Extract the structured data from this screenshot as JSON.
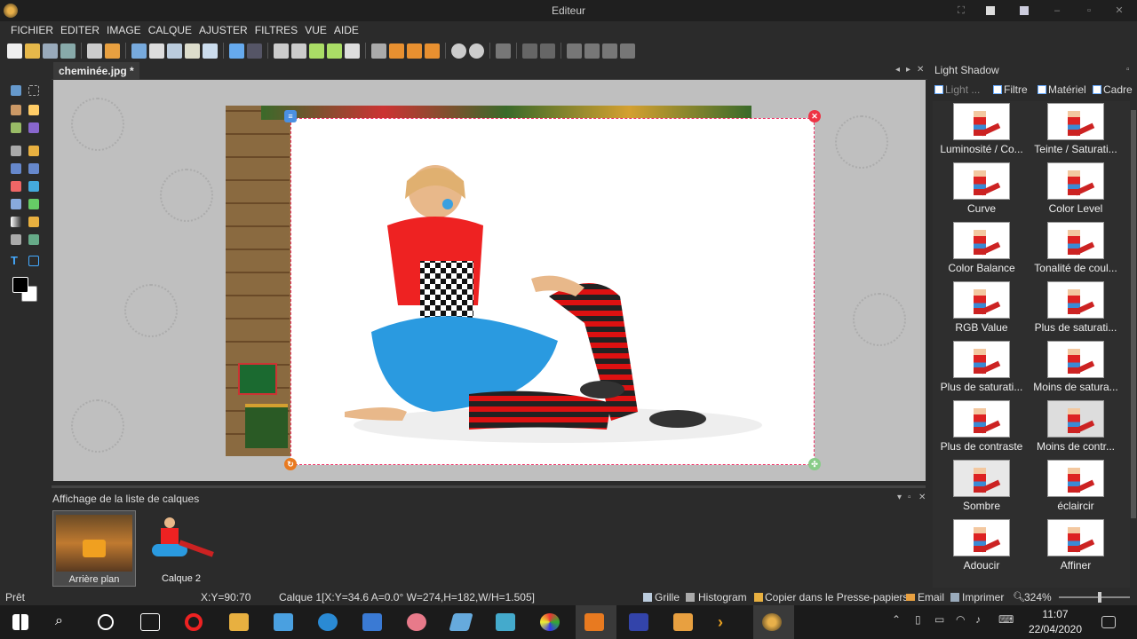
{
  "window": {
    "title": "Editeur"
  },
  "menu": [
    "FICHIER",
    "EDITER",
    "IMAGE",
    "CALQUE",
    "AJUSTER",
    "FILTRES",
    "VUE",
    "AIDE"
  ],
  "document": {
    "tab_label": "cheminée.jpg *"
  },
  "right_panel": {
    "title": "Light Shadow",
    "tabs": [
      "Light ...",
      "Filtre",
      "Matériel",
      "Cadre"
    ],
    "effects": [
      "Luminosité / Co...",
      "Teinte / Saturati...",
      "Curve",
      "Color Level",
      "Color Balance",
      "Tonalité de coul...",
      "RGB Value",
      "Plus de saturati...",
      "Plus de saturati...",
      "Moins de satura...",
      "Plus de contraste",
      "Moins de contr...",
      "Sombre",
      "éclaircir",
      "Adoucir",
      "Affiner"
    ]
  },
  "layers_panel": {
    "title": "Affichage de la liste de calques",
    "layers": [
      "Arrière plan",
      "Calque 2"
    ]
  },
  "status": {
    "state": "Prêt",
    "coords": "X:Y=90:70",
    "layer_info": "Calque 1[X:Y=34.6 A=0.0° W=274,H=182,W/H=1.505]",
    "grid": "Grille",
    "histogram": "Histogram",
    "copy": "Copier dans le Presse-papiers",
    "email": "Email",
    "print": "Imprimer",
    "zoom": "324%"
  },
  "taskbar": {
    "time": "11:07",
    "date": "22/04/2020"
  },
  "icons": {
    "app": "gear-icon",
    "close_handle": "close-icon",
    "rotate_handle": "rotate-icon",
    "resize_handle": "resize-icon"
  }
}
